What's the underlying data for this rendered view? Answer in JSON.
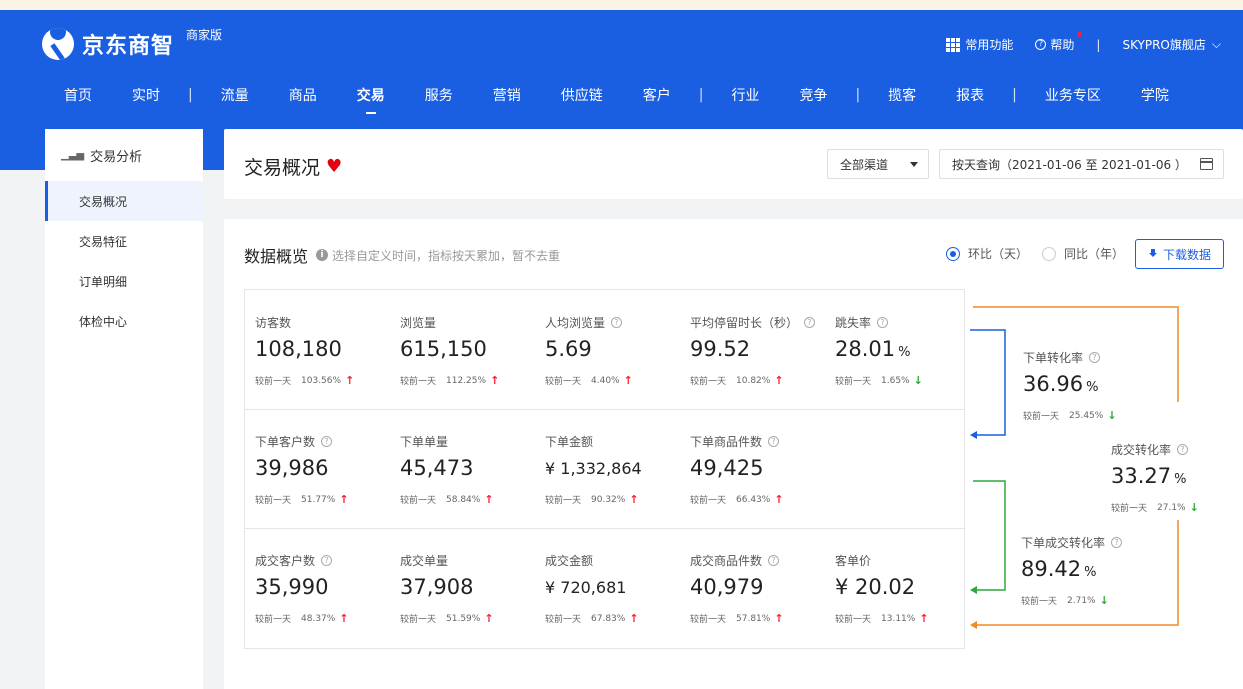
{
  "header": {
    "logo_text": "京东商智",
    "logo_badge": "商家版",
    "common_label": "常用功能",
    "help_label": "帮助",
    "shop_name": "SKYPRO旗舰店",
    "colors": {
      "brand": "#1a5fe2",
      "up": "#f5222d",
      "down": "#2fa839"
    }
  },
  "nav": [
    "首页",
    "实时",
    "流量",
    "商品",
    "交易",
    "服务",
    "营销",
    "供应链",
    "客户",
    "行业",
    "竞争",
    "揽客",
    "报表",
    "业务专区",
    "学院"
  ],
  "sidebar": {
    "heading": "交易分析",
    "items": [
      "交易概况",
      "交易特征",
      "订单明细",
      "体检中心"
    ]
  },
  "page": {
    "title": "交易概况",
    "channel": "全部渠道",
    "date_range": "按天查询（2021-01-06 至 2021-01-06 ）"
  },
  "overview": {
    "title": "数据概览",
    "tip": "选择自定义时间，指标按天累加，暂不去重",
    "radio_1": "环比（天）",
    "radio_2": "同比（年）",
    "download": "下载数据",
    "compare_label": "较前一天"
  },
  "rows": [
    [
      {
        "label": "访客数",
        "value": "108,180",
        "pct": "103.56%",
        "dir": "up",
        "q": false
      },
      {
        "label": "浏览量",
        "value": "615,150",
        "pct": "112.25%",
        "dir": "up",
        "q": false
      },
      {
        "label": "人均浏览量",
        "value": "5.69",
        "pct": "4.40%",
        "dir": "up",
        "q": true
      },
      {
        "label": "平均停留时长（秒）",
        "value": "99.52",
        "pct": "10.82%",
        "dir": "up",
        "q": true
      },
      {
        "label": "跳失率",
        "value": "28.01",
        "unit": "%",
        "pct": "1.65%",
        "dir": "down",
        "q": true
      }
    ],
    [
      {
        "label": "下单客户数",
        "value": "39,986",
        "pct": "51.77%",
        "dir": "up",
        "q": true
      },
      {
        "label": "下单单量",
        "value": "45,473",
        "pct": "58.84%",
        "dir": "up",
        "q": false
      },
      {
        "label": "下单金额",
        "value": "¥ 1,332,864",
        "pct": "90.32%",
        "dir": "up",
        "q": false,
        "small": true
      },
      {
        "label": "下单商品件数",
        "value": "49,425",
        "pct": "66.43%",
        "dir": "up",
        "q": true
      }
    ],
    [
      {
        "label": "成交客户数",
        "value": "35,990",
        "pct": "48.37%",
        "dir": "up",
        "q": true
      },
      {
        "label": "成交单量",
        "value": "37,908",
        "pct": "51.59%",
        "dir": "up",
        "q": false
      },
      {
        "label": "成交金额",
        "value": "¥ 720,681",
        "pct": "67.83%",
        "dir": "up",
        "q": false,
        "small": true
      },
      {
        "label": "成交商品件数",
        "value": "40,979",
        "pct": "57.81%",
        "dir": "up",
        "q": true
      },
      {
        "label": "客单价",
        "value": "¥ 20.02",
        "pct": "13.11%",
        "dir": "up",
        "q": false
      }
    ]
  ],
  "flow": [
    {
      "label": "下单转化率",
      "value": "36.96",
      "unit": "%",
      "pct": "25.45%",
      "dir": "down"
    },
    {
      "label": "成交转化率",
      "value": "33.27",
      "unit": "%",
      "pct": "27.1%",
      "dir": "down"
    },
    {
      "label": "下单成交转化率",
      "value": "89.42",
      "unit": "%",
      "pct": "2.71%",
      "dir": "down"
    }
  ]
}
